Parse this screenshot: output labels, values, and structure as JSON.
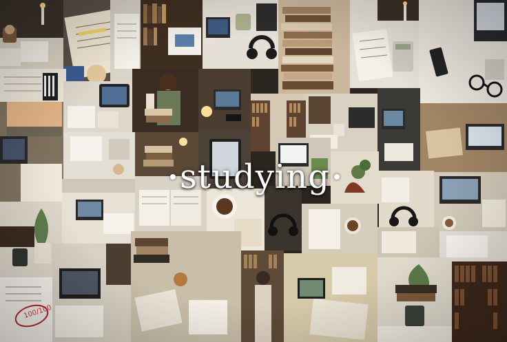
{
  "collage": {
    "title": "studying",
    "grade_mark": "100/100"
  },
  "colors": {
    "warm_dark": "#2b2620",
    "paper": "#e9e4da",
    "wood": "#6b4a2e",
    "title_text": "#ffffff",
    "grade_red": "#b3262b"
  }
}
